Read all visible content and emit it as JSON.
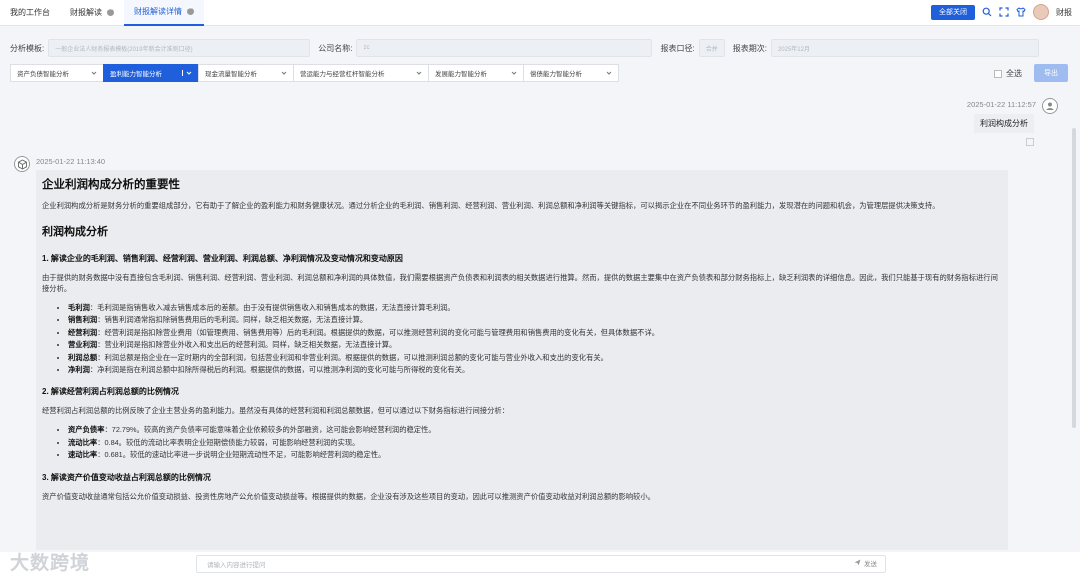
{
  "tabs": [
    {
      "label": "我的工作台",
      "closable": false,
      "active": false
    },
    {
      "label": "财报解读",
      "closable": true,
      "active": false
    },
    {
      "label": "财报解读详情",
      "closable": true,
      "active": true
    }
  ],
  "toolbar": {
    "close_all": "全部关闭",
    "user_name": "财报"
  },
  "filters": {
    "template_label": "分析模板:",
    "template_value": "一般企业法人财务报表模板(2019年新会计准则口径)",
    "company_label": "公司名称:",
    "company_value": "zc",
    "caliber_label": "报表口径:",
    "caliber_value": "合并",
    "period_label": "报表期次:",
    "period_value": "2025年12月"
  },
  "analysis_tabs": [
    {
      "label": "资产负债智能分析",
      "active": false
    },
    {
      "label": "盈利能力智能分析",
      "active": true
    },
    {
      "label": "现金流量智能分析",
      "active": false
    },
    {
      "label": "营运能力与经营杠杆智能分析",
      "active": false
    },
    {
      "label": "发展能力智能分析",
      "active": false
    },
    {
      "label": "偿债能力智能分析",
      "active": false
    }
  ],
  "select_all": "全选",
  "export_label": "导出",
  "user_message": {
    "time": "2025-01-22 11:12:57",
    "text": "利润构成分析"
  },
  "bot_message": {
    "time": "2025-01-22 11:13:40",
    "h1": "企业利润构成分析的重要性",
    "intro": "企业利润构成分析是财务分析的重要组成部分，它有助于了解企业的盈利能力和财务健康状况。通过分析企业的毛利润、销售利润、经营利润、营业利润、利润总额和净利润等关键指标，可以揭示企业在不同业务环节的盈利能力，发现潜在的问题和机会，为管理层提供决策支持。",
    "h2": "利润构成分析",
    "s1_title": "1. 解读企业的毛利润、销售利润、经营利润、营业利润、利润总额、净利润情况及变动情况和变动原因",
    "s1_para": "由于提供的财务数据中没有直接包含毛利润、销售利润、经营利润、营业利润、利润总额和净利润的具体数值，我们需要根据资产负债表和利润表的相关数据进行推算。然而，提供的数据主要集中在资产负债表和部分财务指标上，缺乏利润表的详细信息。因此，我们只能基于现有的财务指标进行间接分析。",
    "s1_items": [
      {
        "term": "毛利润",
        "text": "：毛利润是指销售收入减去销售成本后的差额。由于没有提供销售收入和销售成本的数据，无法直接计算毛利润。"
      },
      {
        "term": "销售利润",
        "text": "：销售利润通常指扣除销售费用后的毛利润。同样，缺乏相关数据，无法直接计算。"
      },
      {
        "term": "经营利润",
        "text": "：经营利润是指扣除营业费用（如管理费用、销售费用等）后的毛利润。根据提供的数据，可以推测经营利润的变化可能与管理费用和销售费用的变化有关，但具体数据不详。"
      },
      {
        "term": "营业利润",
        "text": "：营业利润是指扣除营业外收入和支出后的经营利润。同样，缺乏相关数据，无法直接计算。"
      },
      {
        "term": "利润总额",
        "text": "：利润总额是指企业在一定时期内的全部利润，包括营业利润和非营业利润。根据提供的数据，可以推测利润总额的变化可能与营业外收入和支出的变化有关。"
      },
      {
        "term": "净利润",
        "text": "：净利润是指在利润总额中扣除所得税后的利润。根据提供的数据，可以推测净利润的变化可能与所得税的变化有关。"
      }
    ],
    "s2_title": "2. 解读经营利润占利润总额的比例情况",
    "s2_para": "经营利润占利润总额的比例反映了企业主营业务的盈利能力。虽然没有具体的经营利润和利润总额数据，但可以通过以下财务指标进行间接分析：",
    "s2_items": [
      {
        "term": "资产负债率",
        "text": "：72.79%。较高的资产负债率可能意味着企业依赖较多的外部融资，这可能会影响经营利润的稳定性。"
      },
      {
        "term": "流动比率",
        "text": "：0.84。较低的流动比率表明企业短期偿债能力较弱，可能影响经营利润的实现。"
      },
      {
        "term": "速动比率",
        "text": "：0.681。较低的速动比率进一步说明企业短期流动性不足，可能影响经营利润的稳定性。"
      }
    ],
    "s3_title": "3. 解读资产价值变动收益占利润总额的比例情况",
    "s3_para": "资产价值变动收益通常包括公允价值变动损益、投资性房地产公允价值变动损益等。根据提供的数据，企业没有涉及这些项目的变动，因此可以推测资产价值变动收益对利润总额的影响较小。"
  },
  "input": {
    "placeholder": "请输入内容进行提问",
    "send_label": "发送"
  },
  "watermark": "大数跨境",
  "colors": {
    "primary": "#1f5fdb",
    "export_disabled": "#9fbcf0"
  }
}
